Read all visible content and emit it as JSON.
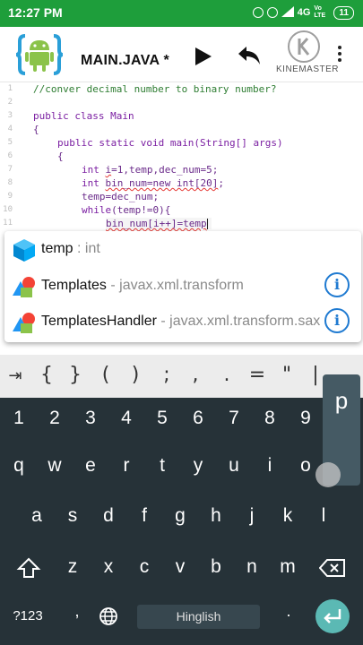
{
  "status_bar": {
    "time": "12:27 PM",
    "network": "4G",
    "volte": "Vo LTE",
    "battery": "11"
  },
  "app_bar": {
    "title": "MAIN.JAVA *",
    "watermark": "KINEMASTER"
  },
  "editor": {
    "line_numbers": [
      "1",
      "2",
      "3",
      "4",
      "5",
      "6",
      "7",
      "8",
      "9",
      "10",
      "11"
    ],
    "line1": "//conver decimal number to binary number?",
    "line3": "public class Main",
    "line4": "{",
    "line5": "public static void main(String[] args)",
    "line6": "{",
    "line7_kw": "int ",
    "line7_err": "i",
    "line7_rest": "=1,temp,dec_num=5;",
    "line8_kw": "int ",
    "line8_err": "bin_num=new int[20]",
    "line8_rest": ";",
    "line9": "temp=dec_num;",
    "line10_kw": "while",
    "line10_rest": "(temp!=0){",
    "line11_err": "bin_num[i++]=temp"
  },
  "autocomplete": {
    "items": [
      {
        "name": "temp",
        "detail": " : int",
        "icon": "cube-icon"
      },
      {
        "name": "Templates",
        "detail": " - javax.xml.transform",
        "icon": "class-icon"
      },
      {
        "name": "TemplatesHandler",
        "detail": " - javax.xml.transform.sax",
        "icon": "class-icon"
      }
    ],
    "info_symbol": "i"
  },
  "symbol_bar": [
    "⇥",
    "{",
    "}",
    "(",
    ")",
    ";",
    ",",
    ".",
    "=",
    "\"",
    "|"
  ],
  "keyboard": {
    "row_numbers": [
      "1",
      "2",
      "3",
      "4",
      "5",
      "6",
      "7",
      "8",
      "9"
    ],
    "row_q": [
      "q",
      "w",
      "e",
      "r",
      "t",
      "y",
      "u",
      "i",
      "o"
    ],
    "row_a": [
      "a",
      "s",
      "d",
      "f",
      "g",
      "h",
      "j",
      "k",
      "l"
    ],
    "row_z": [
      "z",
      "x",
      "c",
      "v",
      "b",
      "n",
      "m"
    ],
    "symbols_key": "?123",
    "space_label": "Hinglish",
    "popup_key": "p",
    "comma": ",",
    "period": "."
  },
  "colors": {
    "status_bar": "#1e9e3b",
    "keyboard_bg": "#263238",
    "enter_key": "#5bb9b4",
    "info_icon": "#1f7ad1"
  }
}
